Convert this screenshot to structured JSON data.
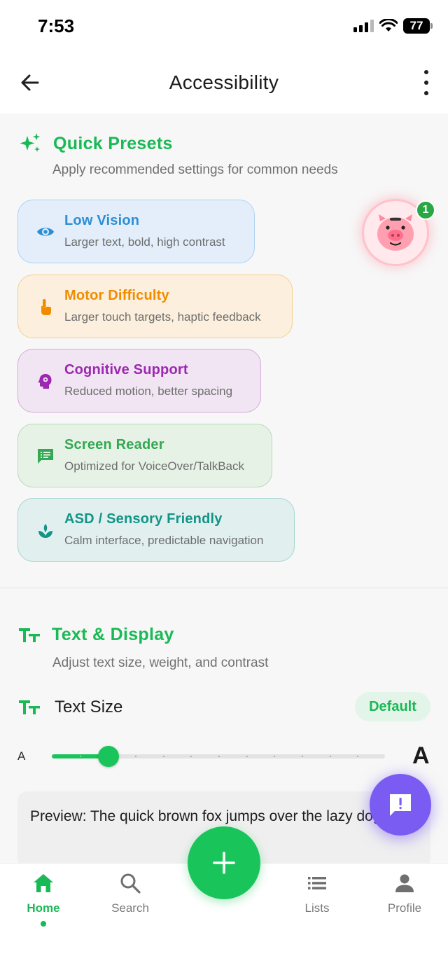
{
  "status_bar": {
    "time": "7:53",
    "battery": "77"
  },
  "app_bar": {
    "title": "Accessibility"
  },
  "quick_presets": {
    "title": "Quick Presets",
    "subtitle": "Apply recommended settings for common needs",
    "items": [
      {
        "title": "Low Vision",
        "desc": "Larger text, bold, high contrast",
        "icon": "eye-icon",
        "color": "#2b8fd6",
        "bg": "#e3eefa",
        "border": "#aed2f1"
      },
      {
        "title": "Motor Difficulty",
        "desc": "Larger touch targets, haptic feedback",
        "icon": "touch-icon",
        "color": "#f08c00",
        "bg": "#fcefdd",
        "border": "#f6cf8f"
      },
      {
        "title": "Cognitive Support",
        "desc": "Reduced motion, better spacing",
        "icon": "brain-icon",
        "color": "#9c27b0",
        "bg": "#f1e4f3",
        "border": "#d9a9e0"
      },
      {
        "title": "Screen Reader",
        "desc": "Optimized for VoiceOver/TalkBack",
        "icon": "chat-list-icon",
        "color": "#34a853",
        "bg": "#e7f2e6",
        "border": "#b4dbb4"
      },
      {
        "title": "ASD / Sensory Friendly",
        "desc": "Calm interface, predictable navigation",
        "icon": "lotus-icon",
        "color": "#129487",
        "bg": "#e1efee",
        "border": "#a5d6d1"
      }
    ]
  },
  "text_display": {
    "title": "Text & Display",
    "subtitle": "Adjust text size, weight, and contrast",
    "text_size_label": "Text Size",
    "text_size_badge": "Default",
    "slider": {
      "min_label": "A",
      "max_label": "A",
      "value_fraction": 0.17
    },
    "preview": "Preview: The quick brown fox jumps over the lazy dog."
  },
  "floating": {
    "pig_badge": "1"
  },
  "bottom_nav": {
    "items": [
      {
        "label": "Home",
        "active": true
      },
      {
        "label": "Search",
        "active": false
      },
      {
        "label": "Lists",
        "active": false
      },
      {
        "label": "Profile",
        "active": false
      }
    ]
  },
  "colors": {
    "accent": "#19c55a",
    "feedback": "#7b5cf2"
  }
}
